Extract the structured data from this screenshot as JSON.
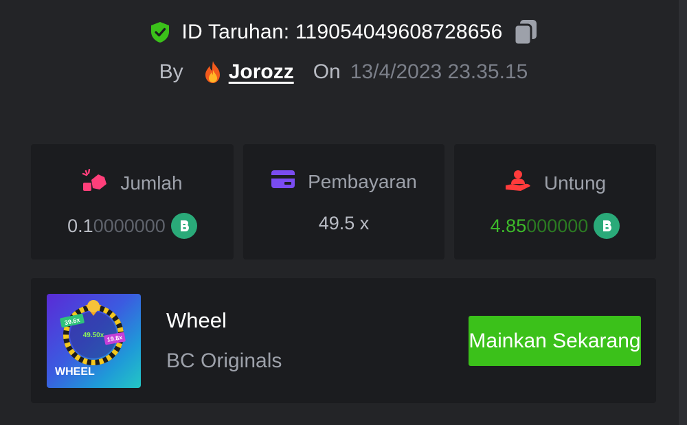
{
  "header": {
    "bet_id_label": "ID Taruhan: 119054049608728656",
    "by_label": "By",
    "username": "Jorozz",
    "on_label": "On",
    "datetime": "13/4/2023 23.35.15"
  },
  "stats": {
    "amount": {
      "label": "Jumlah",
      "value_main": "0.1",
      "value_trail": "0000000",
      "icon": "money-hand-icon"
    },
    "payout": {
      "label": "Pembayaran",
      "value": "49.5 x",
      "icon": "card-icon"
    },
    "profit": {
      "label": "Untung",
      "value_main": "4.85",
      "value_trail": "000000",
      "icon": "profit-hand-icon"
    }
  },
  "game": {
    "title": "Wheel",
    "provider": "BC Originals",
    "play_label": "Mainkan Sekarang",
    "thumb_text": "WHEEL",
    "thumb_multipliers": [
      "39.6x",
      "49.50x",
      "19.8x"
    ]
  },
  "colors": {
    "background": "#232427",
    "card": "#1b1c1f",
    "accent_green": "#3bc11a",
    "profit_green": "#3dbb2a",
    "coin": "#2aaa79",
    "shield": "#3bc11a"
  }
}
